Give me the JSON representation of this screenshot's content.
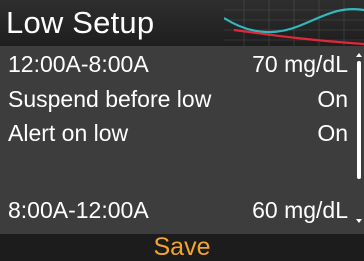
{
  "header": {
    "title": "Low Setup"
  },
  "settings": [
    {
      "label": "12:00A-8:00A",
      "value": "70 mg/dL"
    },
    {
      "label": "Suspend before low",
      "value": "On"
    },
    {
      "label": "Alert on low",
      "value": "On"
    },
    {
      "label": "",
      "value": ""
    },
    {
      "label": "8:00A-12:00A",
      "value": "60 mg/dL"
    }
  ],
  "footer": {
    "save_label": "Save"
  },
  "colors": {
    "accent": "#f2a52a",
    "graph_line_cyan": "#35d0d8",
    "graph_line_red": "#e0283a",
    "content_bg": "#3d3d3d"
  },
  "icons": {
    "header_graph": "glucose-trend-graph-icon"
  }
}
